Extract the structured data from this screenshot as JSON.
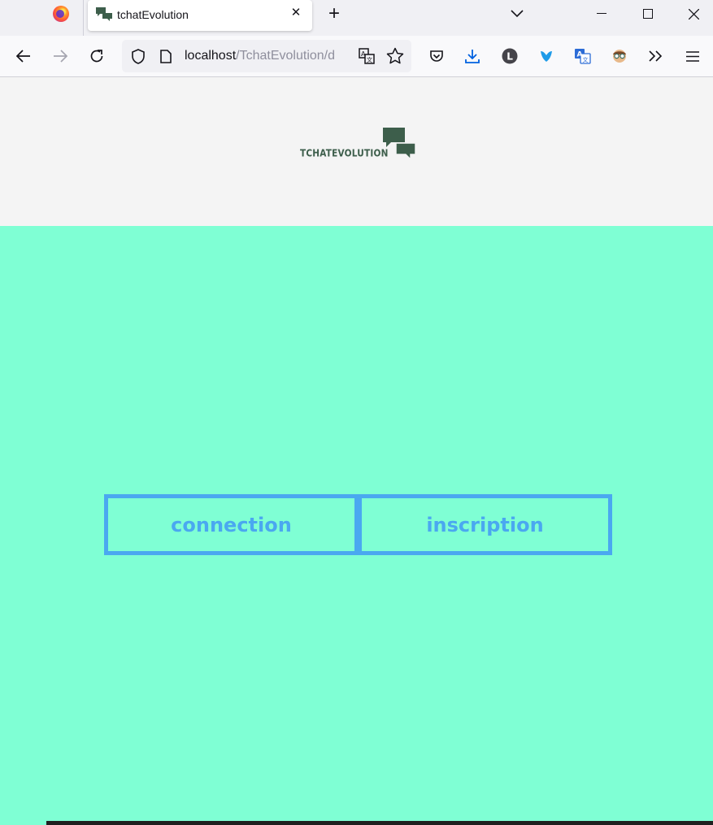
{
  "browser": {
    "tab_title": "tchatEvolution",
    "url_host": "localhost",
    "url_path": "/TchatEvolution/d",
    "extension_badge": "0",
    "icons": [
      "firefox-icon",
      "back-arrow-icon",
      "forward-arrow-icon",
      "reload-icon",
      "shield-icon",
      "page-icon",
      "translate-icon",
      "star-icon",
      "pocket-icon",
      "download-icon",
      "extension-l-icon",
      "extension-bird-icon",
      "translate-extension-icon",
      "avatar-extension-icon",
      "overflow-chevron-icon",
      "menu-icon"
    ]
  },
  "site": {
    "logo_text": "TCHATEVOLUTION",
    "logo_color": "#3d5e4b",
    "background_color": "#7fffd4",
    "accent_color": "#4aa8f0",
    "buttons": {
      "connection": "connection",
      "inscription": "inscription"
    }
  }
}
